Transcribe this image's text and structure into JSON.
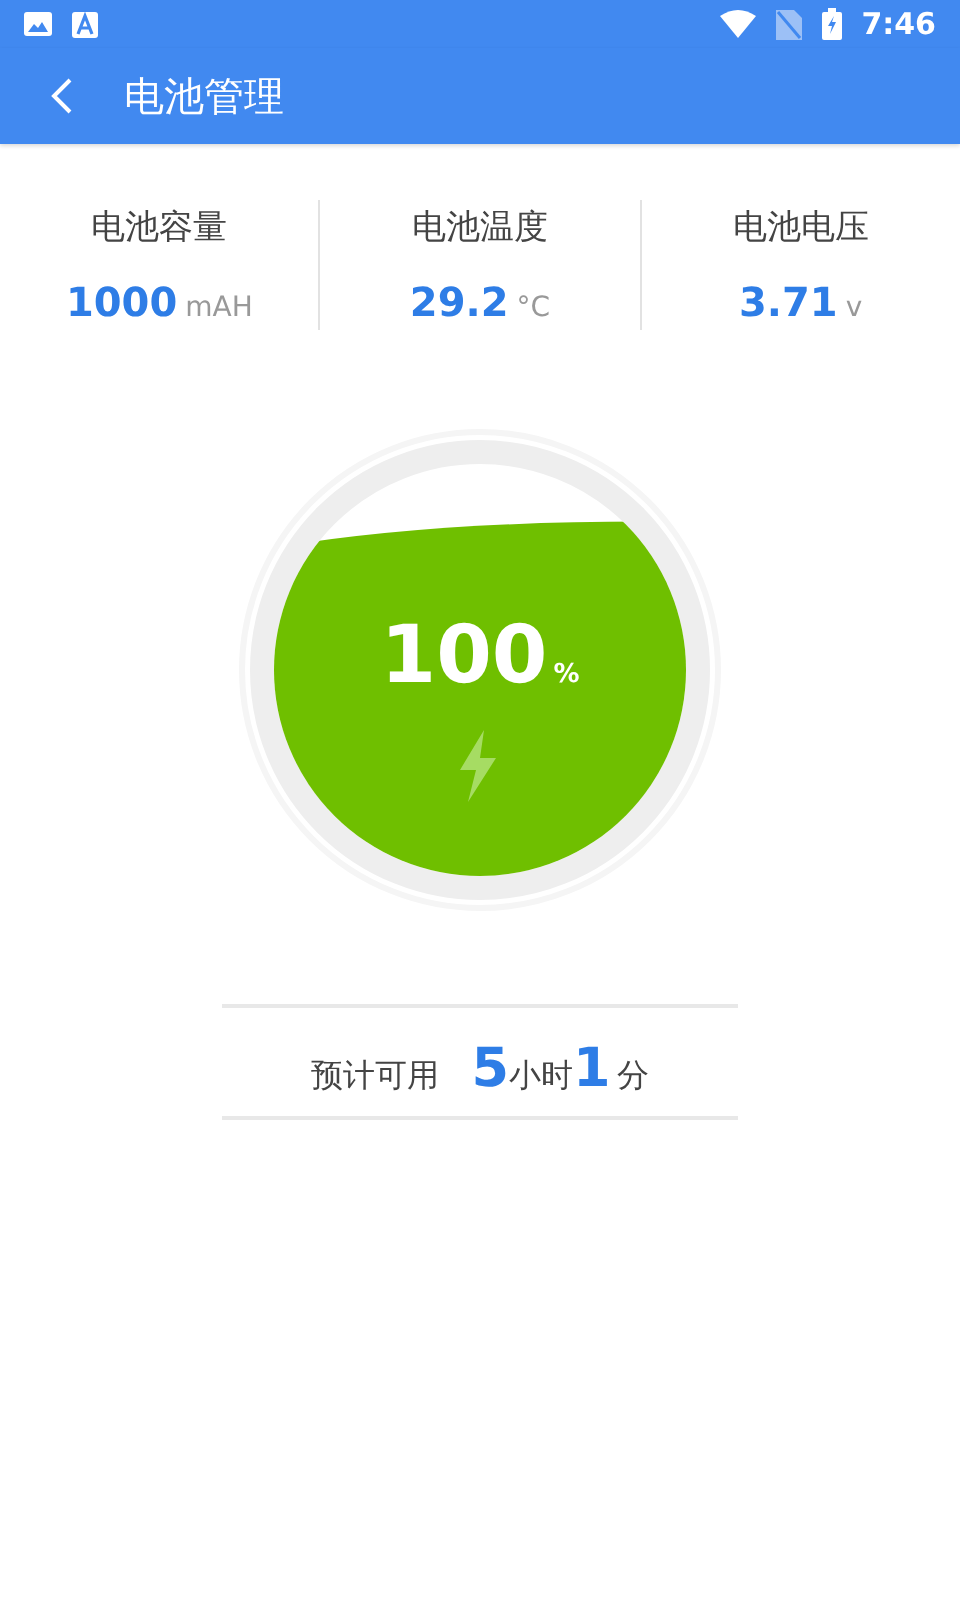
{
  "status_bar": {
    "time": "7:46"
  },
  "toolbar": {
    "title": "电池管理"
  },
  "stats": [
    {
      "label": "电池容量",
      "value": "1000",
      "unit": "mAH"
    },
    {
      "label": "电池温度",
      "value": "29.2",
      "unit": "°C"
    },
    {
      "label": "电池电压",
      "value": "3.71",
      "unit": "v"
    }
  ],
  "gauge": {
    "percent": "100",
    "percent_unit": "%",
    "charging": true
  },
  "estimate": {
    "label": "预计可用",
    "hours": "5",
    "hours_unit": "小时",
    "minutes": "1",
    "minutes_unit": "分"
  }
}
